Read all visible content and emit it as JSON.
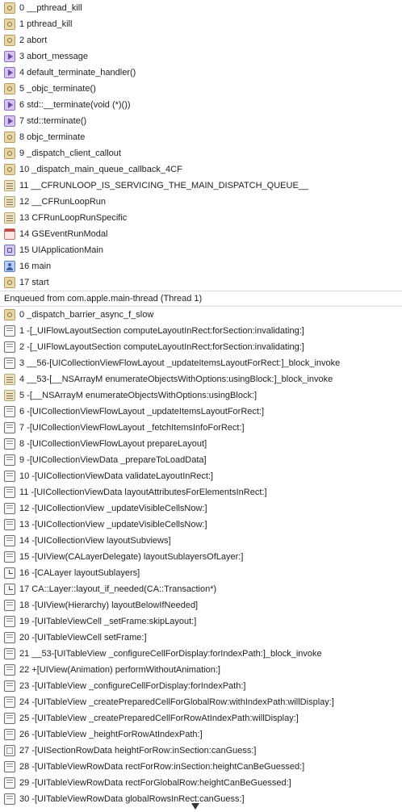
{
  "main_thread_frames": [
    {
      "label": "0 __pthread_kill",
      "icon": "gear-icon"
    },
    {
      "label": "1 pthread_kill",
      "icon": "gear-icon"
    },
    {
      "label": "2 abort",
      "icon": "gear-icon"
    },
    {
      "label": "3 abort_message",
      "icon": "play-icon"
    },
    {
      "label": "4 default_terminate_handler()",
      "icon": "play-icon"
    },
    {
      "label": "5 _objc_terminate()",
      "icon": "gear-icon"
    },
    {
      "label": "6 std::__terminate(void (*)())",
      "icon": "play-icon"
    },
    {
      "label": "7 std::terminate()",
      "icon": "play-icon"
    },
    {
      "label": "8 objc_terminate",
      "icon": "gear-icon"
    },
    {
      "label": "9 _dispatch_client_callout",
      "icon": "gear-icon"
    },
    {
      "label": "10 _dispatch_main_queue_callback_4CF",
      "icon": "gear-icon"
    },
    {
      "label": "11 __CFRUNLOOP_IS_SERVICING_THE_MAIN_DISPATCH_QUEUE__",
      "icon": "lines-icon"
    },
    {
      "label": "12 __CFRunLoopRun",
      "icon": "lines-icon"
    },
    {
      "label": "13 CFRunLoopRunSpecific",
      "icon": "lines-icon"
    },
    {
      "label": "14 GSEventRunModal",
      "icon": "calendar-icon"
    },
    {
      "label": "15 UIApplicationMain",
      "icon": "app-icon"
    },
    {
      "label": "16 main",
      "icon": "user-icon"
    },
    {
      "label": "17 start",
      "icon": "gear-icon"
    }
  ],
  "thread_header": "Enqueued from com.apple.main-thread (Thread 1)",
  "enqueued_frames": [
    {
      "label": "0 _dispatch_barrier_async_f_slow",
      "icon": "gear-icon"
    },
    {
      "label": "1 -[_UIFlowLayoutSection computeLayoutInRect:forSection:invalidating:]",
      "icon": "doc-icon"
    },
    {
      "label": "2 -[_UIFlowLayoutSection computeLayoutInRect:forSection:invalidating:]",
      "icon": "doc-icon"
    },
    {
      "label": "3 __56-[UICollectionViewFlowLayout _updateItemsLayoutForRect:]_block_invoke",
      "icon": "doc-icon"
    },
    {
      "label": "4 __53-[__NSArrayM enumerateObjectsWithOptions:usingBlock:]_block_invoke",
      "icon": "lines-icon"
    },
    {
      "label": "5 -[__NSArrayM enumerateObjectsWithOptions:usingBlock:]",
      "icon": "lines-icon"
    },
    {
      "label": "6 -[UICollectionViewFlowLayout _updateItemsLayoutForRect:]",
      "icon": "doc-icon"
    },
    {
      "label": "7 -[UICollectionViewFlowLayout _fetchItemsInfoForRect:]",
      "icon": "doc-icon"
    },
    {
      "label": "8 -[UICollectionViewFlowLayout prepareLayout]",
      "icon": "doc-icon"
    },
    {
      "label": "9 -[UICollectionViewData _prepareToLoadData]",
      "icon": "doc-icon"
    },
    {
      "label": "10 -[UICollectionViewData validateLayoutInRect:]",
      "icon": "doc-icon"
    },
    {
      "label": "11 -[UICollectionViewData layoutAttributesForElementsInRect:]",
      "icon": "doc-icon"
    },
    {
      "label": "12 -[UICollectionView _updateVisibleCellsNow:]",
      "icon": "doc-icon"
    },
    {
      "label": "13 -[UICollectionView _updateVisibleCellsNow:]",
      "icon": "doc-icon"
    },
    {
      "label": "14 -[UICollectionView layoutSubviews]",
      "icon": "doc-icon"
    },
    {
      "label": "15 -[UIView(CALayerDelegate) layoutSublayersOfLayer:]",
      "icon": "doc-icon"
    },
    {
      "label": "16 -[CALayer layoutSublayers]",
      "icon": "clock-icon"
    },
    {
      "label": "17 CA::Layer::layout_if_needed(CA::Transaction*)",
      "icon": "clock-icon"
    },
    {
      "label": "18 -[UIView(Hierarchy) layoutBelowIfNeeded]",
      "icon": "doc-icon"
    },
    {
      "label": "19 -[UITableViewCell _setFrame:skipLayout:]",
      "icon": "doc-icon"
    },
    {
      "label": "20 -[UITableViewCell setFrame:]",
      "icon": "doc-icon"
    },
    {
      "label": "21 __53-[UITableView _configureCellForDisplay:forIndexPath:]_block_invoke",
      "icon": "doc-icon"
    },
    {
      "label": "22 +[UIView(Animation) performWithoutAnimation:]",
      "icon": "doc-icon"
    },
    {
      "label": "23 -[UITableView _configureCellForDisplay:forIndexPath:]",
      "icon": "doc-icon"
    },
    {
      "label": "24 -[UITableView _createPreparedCellForGlobalRow:withIndexPath:willDisplay:]",
      "icon": "doc-icon"
    },
    {
      "label": "25 -[UITableView _createPreparedCellForRowAtIndexPath:willDisplay:]",
      "icon": "doc-icon"
    },
    {
      "label": "26 -[UITableView _heightForRowAtIndexPath:]",
      "icon": "doc-icon"
    },
    {
      "label": "27 -[UISectionRowData heightForRow:inSection:canGuess:]",
      "icon": "box-icon"
    },
    {
      "label": "28 -[UITableViewRowData rectForRow:inSection:heightCanBeGuessed:]",
      "icon": "doc-icon"
    },
    {
      "label": "29 -[UITableViewRowData rectForGlobalRow:heightCanBeGuessed:]",
      "icon": "doc-icon"
    },
    {
      "label": "30 -[UITableViewRowData globalRowsInRect:canGuess:]",
      "icon": "doc-icon"
    }
  ],
  "more_indicator": "chevron-down-icon"
}
